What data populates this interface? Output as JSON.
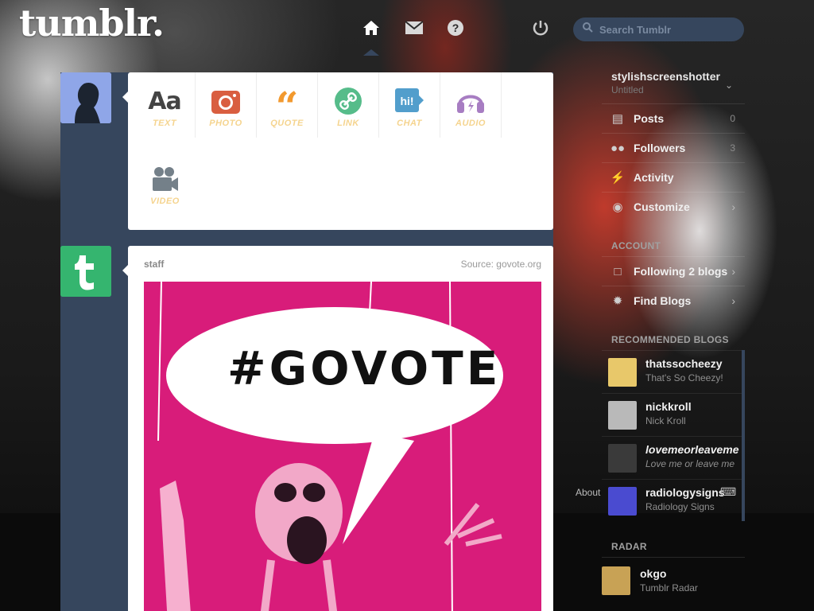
{
  "app": {
    "logo": "tumblr."
  },
  "header": {
    "search_placeholder": "Search Tumblr",
    "icons": [
      "home-icon",
      "mail-icon",
      "help-icon",
      "power-icon"
    ]
  },
  "post_types": [
    {
      "label": "TEXT",
      "icon": "text-icon",
      "color": "#444444"
    },
    {
      "label": "PHOTO",
      "icon": "camera-icon",
      "color": "#d95e40"
    },
    {
      "label": "QUOTE",
      "icon": "quote-icon",
      "color": "#f2992e"
    },
    {
      "label": "LINK",
      "icon": "link-icon",
      "color": "#56bc8a"
    },
    {
      "label": "CHAT",
      "icon": "chat-icon",
      "color": "#529ecc"
    },
    {
      "label": "AUDIO",
      "icon": "headphones-icon",
      "color": "#a77dc2"
    },
    {
      "label": "VIDEO",
      "icon": "video-camera-icon",
      "color": "#748089"
    }
  ],
  "staff_post": {
    "blog": "staff",
    "source": "Source: govote.org",
    "image_text": "#GOVOTE"
  },
  "sidebar": {
    "blog_name": "stylishscreenshotter",
    "blog_sub": "Untitled",
    "items": [
      {
        "label": "Posts",
        "count": "0",
        "icon": "posts-icon"
      },
      {
        "label": "Followers",
        "count": "3",
        "icon": "followers-icon"
      },
      {
        "label": "Activity",
        "count": "",
        "icon": "lightning-icon"
      },
      {
        "label": "Customize",
        "count": "",
        "icon": "eye-icon"
      }
    ],
    "account_header": "ACCOUNT",
    "account_items": [
      {
        "label": "Following 2 blogs",
        "icon": "following-icon"
      },
      {
        "label": "Find Blogs",
        "icon": "compass-icon"
      }
    ],
    "recommended_header": "RECOMMENDED BLOGS",
    "recommended": [
      {
        "name": "thatssocheezy",
        "sub": "That's So Cheezy!"
      },
      {
        "name": "nickkroll",
        "sub": "Nick Kroll"
      },
      {
        "name": "lovemeorleaveme",
        "sub": "Love me or leave me"
      },
      {
        "name": "radiologysigns",
        "sub": "Radiology Signs"
      }
    ],
    "footer_about": "About",
    "radar_header": "RADAR",
    "radar": {
      "name": "okgo",
      "sub": "Tumblr Radar"
    }
  }
}
